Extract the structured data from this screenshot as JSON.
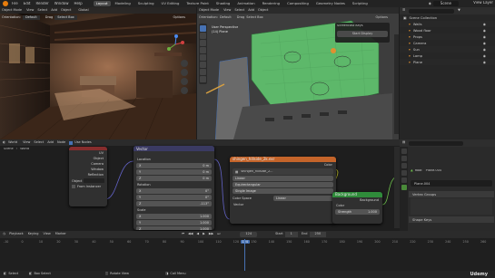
{
  "topbar": {
    "menus": [
      "File",
      "Edit",
      "Render",
      "Window",
      "Help"
    ],
    "workspaces": [
      "Layout",
      "Modeling",
      "Sculpting",
      "UV Editing",
      "Texture Paint",
      "Shading",
      "Animation",
      "Rendering",
      "Compositing",
      "Geometry Nodes",
      "Scripting"
    ],
    "active_workspace": "Layout",
    "scene_label": "Scene",
    "viewlayer_label": "View Layer"
  },
  "viewport_left": {
    "mode": "Object Mode",
    "menus": [
      "View",
      "Select",
      "Add",
      "Object"
    ],
    "orientation_label": "Orientation:",
    "orientation_value": "Default",
    "drag_label": "Drag",
    "drag_value": "Select Box",
    "transform": "Global",
    "options_label": "Options"
  },
  "viewport_right": {
    "mode": "Object Mode",
    "menus": [
      "View",
      "Select",
      "Add",
      "Object"
    ],
    "orientation_label": "Orientation:",
    "orientation_value": "Default",
    "drag_label": "Drag",
    "drag_value": "Select Box",
    "view_label": "User Perspective",
    "collection_label": "(14) Plane",
    "screencast_title": "Screencast Keys",
    "start_display": "Start Display",
    "options_label": "Options"
  },
  "node_editor": {
    "editor_type": "World",
    "menus": [
      "View",
      "Select",
      "Add",
      "Node"
    ],
    "use_nodes": "Use Nodes",
    "breadcrumb": [
      "Scene",
      "World"
    ],
    "world_name": "World"
  },
  "nodes": {
    "texcoord": {
      "outputs": [
        "UV",
        "Object",
        "Camera",
        "Window",
        "Reflection"
      ],
      "object_label": "Object",
      "from_instancer": "From Instancer"
    },
    "mapping": {
      "title": "Vector",
      "location": "Location",
      "rotation": "Rotation",
      "scale": "Scale",
      "vector": "Vector",
      "loc_values": [
        [
          "X",
          "0 m"
        ],
        [
          "Y",
          "0 m"
        ],
        [
          "Z",
          "0 m"
        ]
      ],
      "rot_values": [
        [
          "X",
          "0°"
        ],
        [
          "Y",
          "0°"
        ],
        [
          "Z",
          "-113°"
        ]
      ],
      "scale_values": [
        [
          "X",
          "1.000"
        ],
        [
          "Y",
          "1.000"
        ],
        [
          "Z",
          "1.000"
        ]
      ]
    },
    "envtex": {
      "title": "shingen_hillside_2k.exr",
      "output": "Color",
      "image_name": "shingen_hillside_2...",
      "interp": "Linear",
      "projection": "Equirectangular",
      "source": "Single Image",
      "colorspace_label": "Color Space",
      "colorspace_value": "Linear",
      "vector": "Vector"
    },
    "background": {
      "title": "Background",
      "output": "Background",
      "color": "Color",
      "strength_label": "Strength",
      "strength_value": "1.000"
    }
  },
  "outliner": {
    "title": "Scene Collection",
    "items": [
      "Walls",
      "Wood floor",
      "Props",
      "Camera",
      "Sun",
      "Lamp",
      "Plane"
    ]
  },
  "properties": {
    "breadcrumb": [
      "Plane.004"
    ],
    "object_name": "Plane.004",
    "root_label": "Root",
    "panels": [
      "Vertex Groups",
      "Shape Keys"
    ]
  },
  "timeline": {
    "menus": [
      "Playback",
      "Keying",
      "View",
      "Marker"
    ],
    "current_frame": "124",
    "start_label": "Start",
    "start_value": "1",
    "end_label": "End",
    "end_value": "250",
    "ticks": [
      "-10",
      "0",
      "10",
      "20",
      "30",
      "40",
      "50",
      "60",
      "70",
      "80",
      "90",
      "100",
      "110",
      "120",
      "124",
      "130",
      "140",
      "150",
      "160",
      "170",
      "180",
      "190",
      "200",
      "210",
      "220",
      "230",
      "240",
      "250",
      "260"
    ],
    "current_frame_value": 124
  },
  "statusbar": {
    "items": [
      "Select",
      "Box Select",
      "Rotate View",
      "Call Menu"
    ],
    "watermark": "Udemy"
  },
  "colors": {
    "accent": "#4772b3",
    "node_texture_header": "#c4642a",
    "node_shader_header": "#2f8b3a",
    "plane_green": "#5db86a",
    "frame_blue": "#3b6fd6"
  }
}
